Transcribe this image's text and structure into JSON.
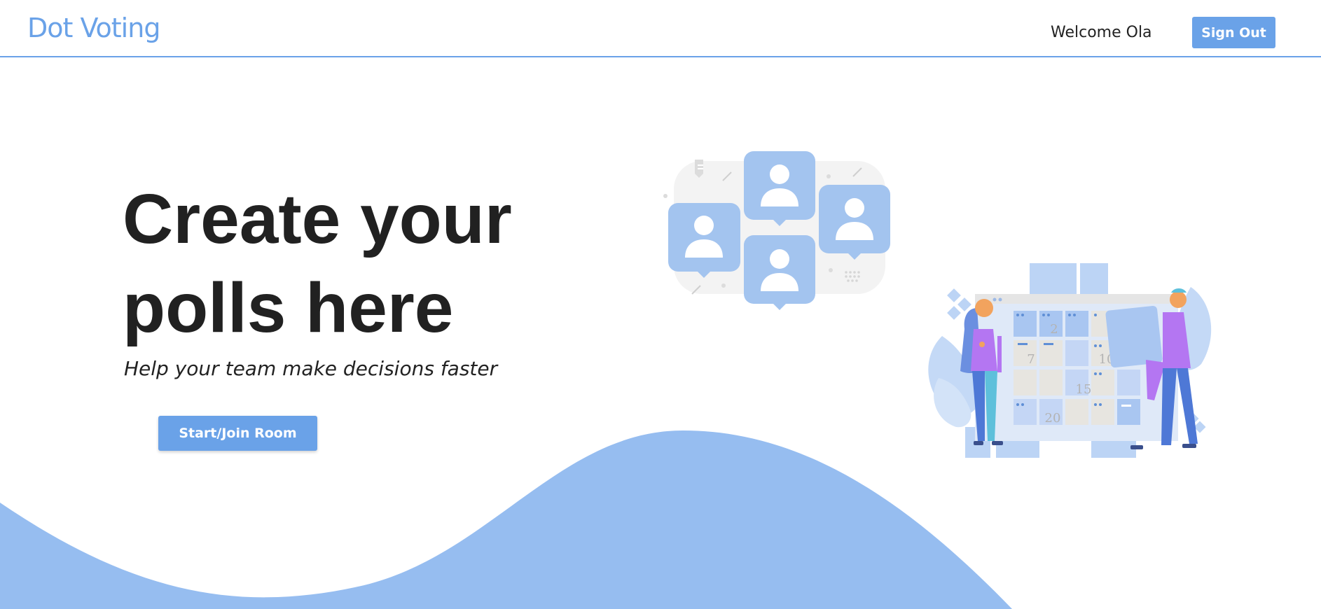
{
  "header": {
    "brand": "Dot Voting",
    "welcome": "Welcome Ola",
    "signout_label": "Sign Out"
  },
  "hero": {
    "title": "Create your polls here",
    "subtitle": "Help your team make decisions faster",
    "cta_label": "Start/Join Room"
  },
  "calendar_illustration": {
    "dates": [
      "2",
      "7",
      "10",
      "15",
      "20"
    ]
  },
  "colors": {
    "accent": "#6aa2e8",
    "wave": "#96bdf0",
    "bubble": "#a3c4ef",
    "title_text": "#212121"
  },
  "icons": {
    "people_bubbles": "user-bubble-icon",
    "calendar_scene": "calendar-planning-illustration"
  }
}
